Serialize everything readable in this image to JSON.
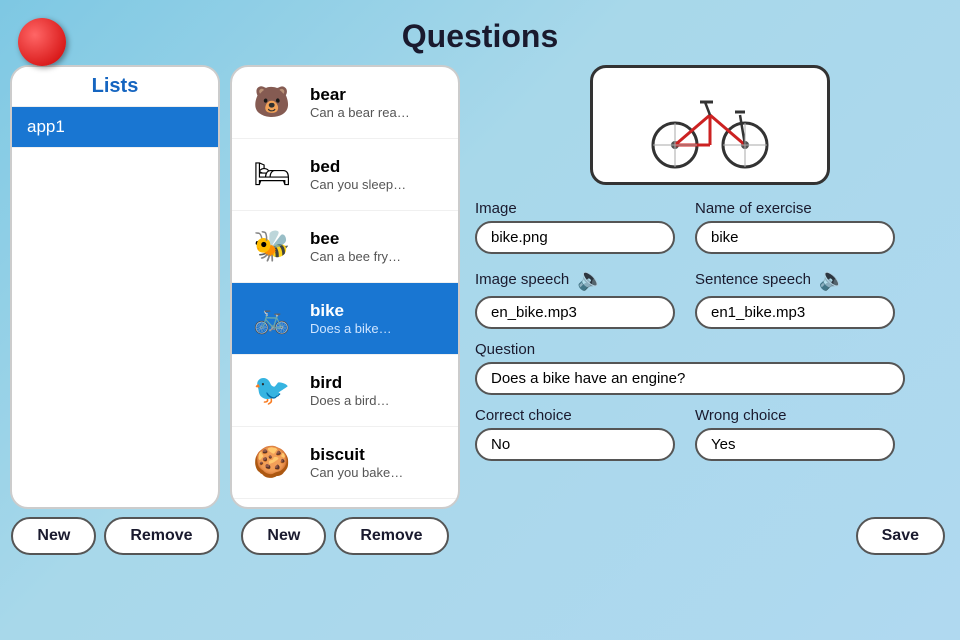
{
  "app": {
    "title": "Questions"
  },
  "lists_panel": {
    "header": "Lists",
    "items": [
      {
        "id": "app1",
        "label": "app1",
        "selected": true
      }
    ],
    "btn_new": "New",
    "btn_remove": "Remove"
  },
  "items_panel": {
    "items": [
      {
        "id": "bear",
        "name": "bear",
        "subtext": "Can a bear rea…",
        "emoji": "🐻",
        "selected": false
      },
      {
        "id": "bed",
        "name": "bed",
        "subtext": "Can you sleep…",
        "emoji": "🛏",
        "selected": false
      },
      {
        "id": "bee",
        "name": "bee",
        "subtext": "Can a bee fry…",
        "emoji": "🐝",
        "selected": false
      },
      {
        "id": "bike",
        "name": "bike",
        "subtext": "Does a bike…",
        "emoji": "🚲",
        "selected": true
      },
      {
        "id": "bird",
        "name": "bird",
        "subtext": "Does a bird…",
        "emoji": "🐦",
        "selected": false
      },
      {
        "id": "biscuit",
        "name": "biscuit",
        "subtext": "Can you bake…",
        "emoji": "🍪",
        "selected": false
      }
    ],
    "btn_new": "New",
    "btn_remove": "Remove"
  },
  "detail": {
    "image_label": "Image",
    "image_value": "bike.png",
    "name_label": "Name of exercise",
    "name_value": "bike",
    "image_speech_label": "Image speech",
    "image_speech_value": "en_bike.mp3",
    "sentence_speech_label": "Sentence speech",
    "sentence_speech_value": "en1_bike.mp3",
    "question_label": "Question",
    "question_value": "Does a bike have an engine?",
    "correct_choice_label": "Correct choice",
    "correct_choice_value": "No",
    "wrong_choice_label": "Wrong choice",
    "wrong_choice_value": "Yes",
    "save_label": "Save"
  },
  "icons": {
    "speaker": "🔈",
    "speaker2": "🔈"
  }
}
